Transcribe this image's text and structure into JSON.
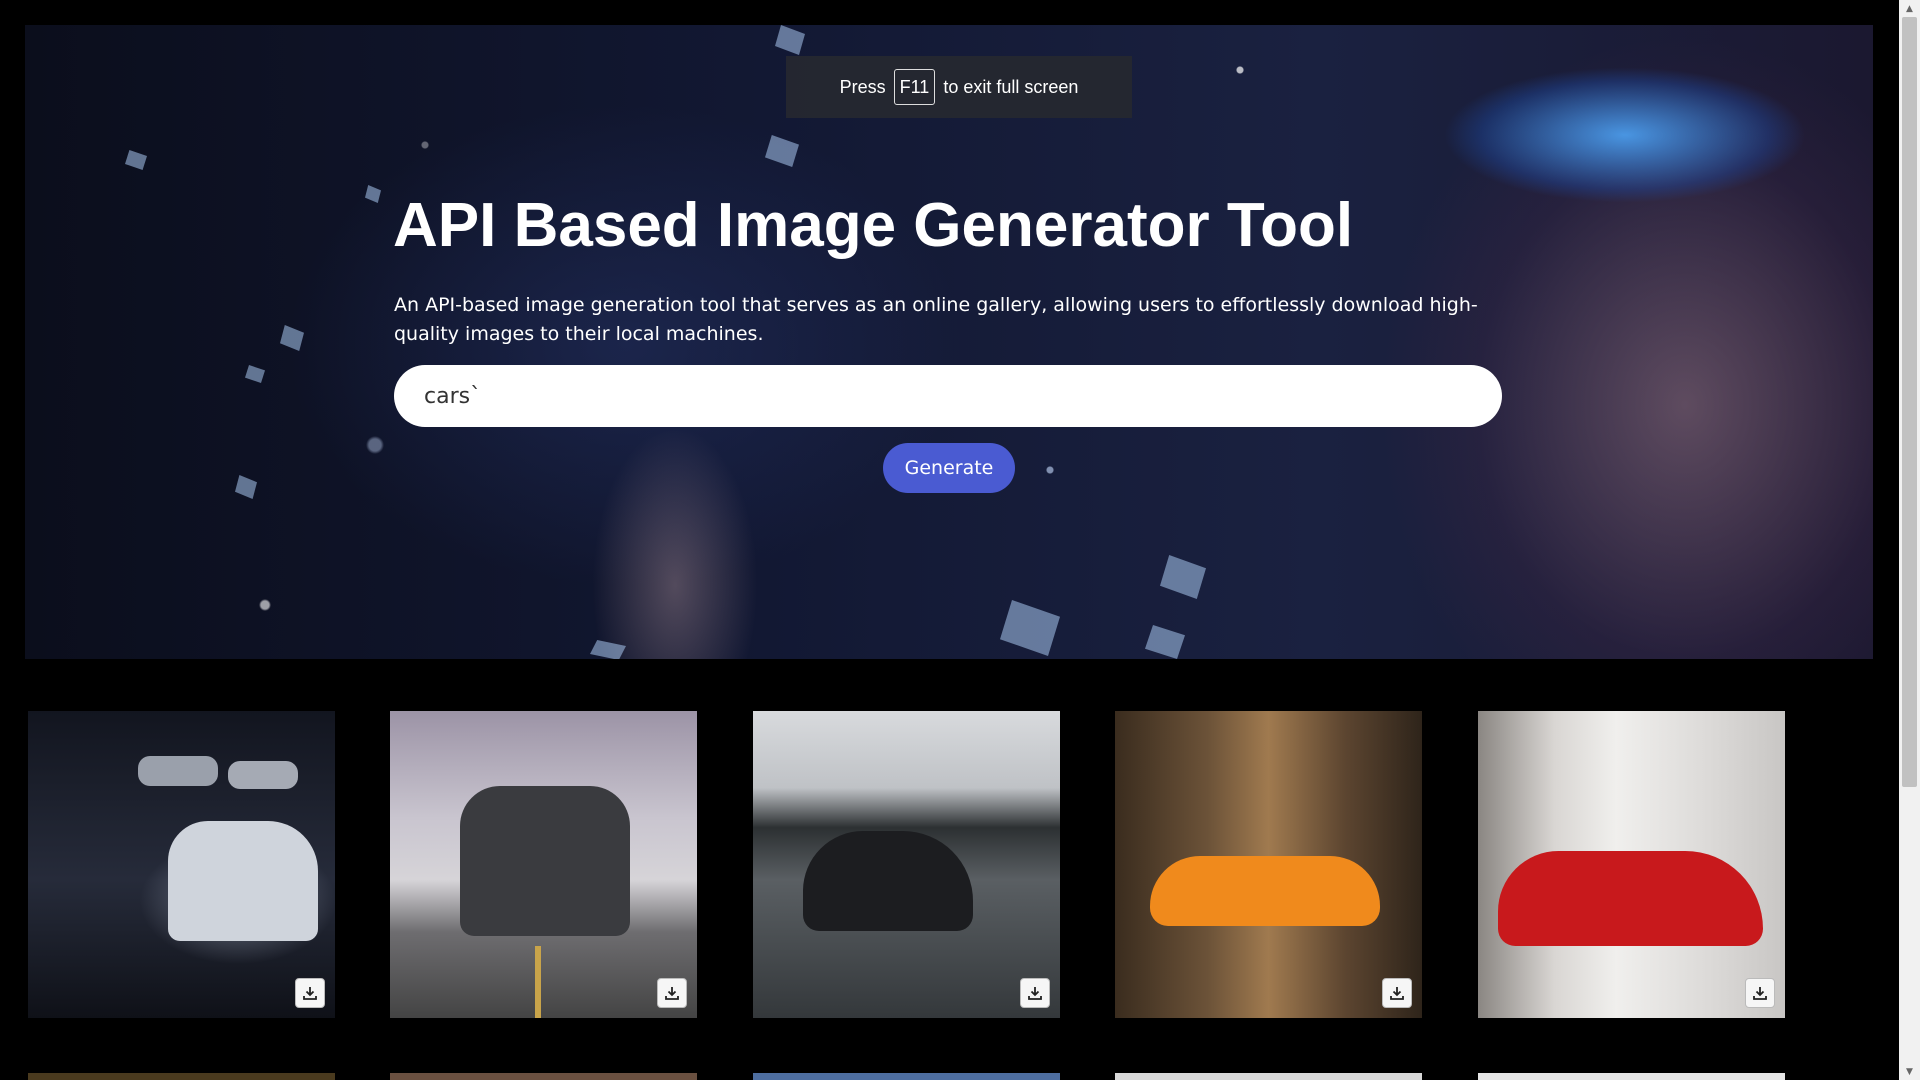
{
  "fullscreen_notice": {
    "prefix": "Press",
    "key": "F11",
    "suffix": "to exit full screen"
  },
  "hero": {
    "title": "API Based Image Generator Tool",
    "description": "An API-based image generation tool that serves as an online gallery, allowing users to effortlessly download high-quality images to their local machines.",
    "search_value": "cars`",
    "generate_label": "Generate"
  },
  "gallery": {
    "images": [
      {
        "subject": "white sports car in dark garage",
        "action_icon": "download-icon"
      },
      {
        "subject": "grey muscle car on road",
        "action_icon": "download-icon"
      },
      {
        "subject": "black sedan driving on highway",
        "action_icon": "download-icon"
      },
      {
        "subject": "orange supercar in forest",
        "action_icon": "download-icon"
      },
      {
        "subject": "red supercar in showroom",
        "action_icon": "download-icon"
      }
    ]
  },
  "colors": {
    "accent": "#4a5bd2",
    "background": "#000000"
  }
}
